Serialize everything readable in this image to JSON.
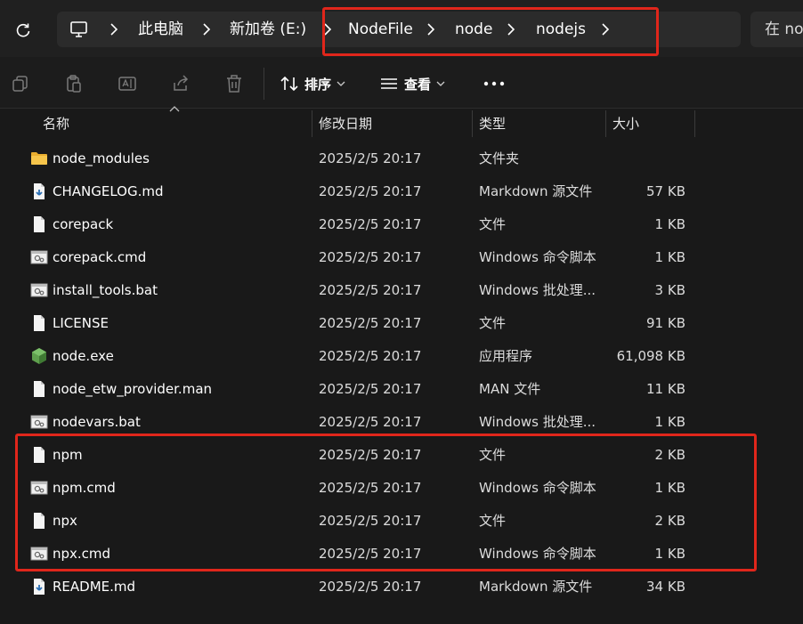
{
  "address_bar": {
    "refresh_icon": "refresh-icon",
    "breadcrumb": [
      {
        "label": ""
      },
      {
        "label": "此电脑"
      },
      {
        "label": "新加卷 (E:)"
      },
      {
        "label": "NodeFile"
      },
      {
        "label": "node"
      },
      {
        "label": "nodejs"
      }
    ],
    "computer_icon": "computer-icon",
    "search_placeholder": "在 no"
  },
  "toolbar": {
    "copy_icon": "copy-icon",
    "paste_icon": "paste-icon",
    "rename_icon": "rename-icon",
    "share_icon": "share-icon",
    "delete_icon": "delete-icon",
    "sort_label": "排序",
    "view_label": "查看",
    "more_label": "•••"
  },
  "columns": {
    "name": "名称",
    "date": "修改日期",
    "type": "类型",
    "size": "大小"
  },
  "files": [
    {
      "name": "node_modules",
      "date": "2025/2/5 20:17",
      "type": "文件夹",
      "size": "",
      "icon": "folder"
    },
    {
      "name": "CHANGELOG.md",
      "date": "2025/2/5 20:17",
      "type": "Markdown 源文件",
      "size": "57 KB",
      "icon": "markdown"
    },
    {
      "name": "corepack",
      "date": "2025/2/5 20:17",
      "type": "文件",
      "size": "1 KB",
      "icon": "file"
    },
    {
      "name": "corepack.cmd",
      "date": "2025/2/5 20:17",
      "type": "Windows 命令脚本",
      "size": "1 KB",
      "icon": "script"
    },
    {
      "name": "install_tools.bat",
      "date": "2025/2/5 20:17",
      "type": "Windows 批处理...",
      "size": "3 KB",
      "icon": "script"
    },
    {
      "name": "LICENSE",
      "date": "2025/2/5 20:17",
      "type": "文件",
      "size": "91 KB",
      "icon": "file"
    },
    {
      "name": "node.exe",
      "date": "2025/2/5 20:17",
      "type": "应用程序",
      "size": "61,098 KB",
      "icon": "node"
    },
    {
      "name": "node_etw_provider.man",
      "date": "2025/2/5 20:17",
      "type": "MAN 文件",
      "size": "11 KB",
      "icon": "file"
    },
    {
      "name": "nodevars.bat",
      "date": "2025/2/5 20:17",
      "type": "Windows 批处理...",
      "size": "1 KB",
      "icon": "script"
    },
    {
      "name": "npm",
      "date": "2025/2/5 20:17",
      "type": "文件",
      "size": "2 KB",
      "icon": "file"
    },
    {
      "name": "npm.cmd",
      "date": "2025/2/5 20:17",
      "type": "Windows 命令脚本",
      "size": "1 KB",
      "icon": "script"
    },
    {
      "name": "npx",
      "date": "2025/2/5 20:17",
      "type": "文件",
      "size": "2 KB",
      "icon": "file"
    },
    {
      "name": "npx.cmd",
      "date": "2025/2/5 20:17",
      "type": "Windows 命令脚本",
      "size": "1 KB",
      "icon": "script"
    },
    {
      "name": "README.md",
      "date": "2025/2/5 20:17",
      "type": "Markdown 源文件",
      "size": "34 KB",
      "icon": "markdown"
    }
  ],
  "colors": {
    "highlight": "#e0261b",
    "background": "#191919",
    "folder": "#f3c24a",
    "node_green": "#5fa04e"
  }
}
